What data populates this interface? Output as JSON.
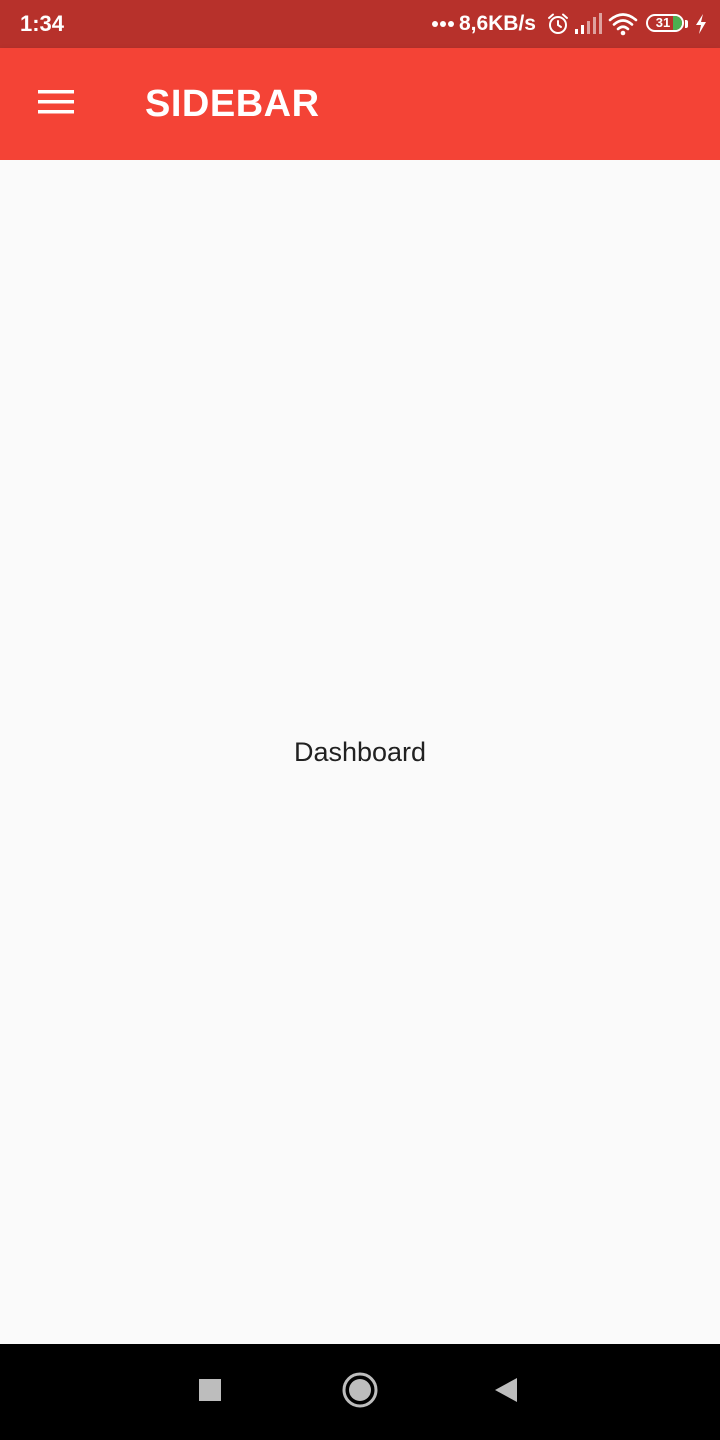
{
  "status_bar": {
    "time": "1:34",
    "network_speed": "8,6KB/s",
    "battery_level": "31",
    "icons": [
      "more-dots-icon",
      "alarm-icon",
      "signal-icon",
      "wifi-icon",
      "battery-icon",
      "charging-icon"
    ]
  },
  "app_bar": {
    "title": "SIDEBAR",
    "menu_icon": "menu-icon"
  },
  "main": {
    "text": "Dashboard"
  },
  "nav_bar": {
    "icons": [
      "recents-icon",
      "home-icon",
      "back-icon"
    ]
  },
  "colors": {
    "status_bar": "#b7312b",
    "app_bar": "#f44336",
    "background": "#fafafa",
    "nav_bar": "#000000",
    "battery_fill": "#4caf50"
  }
}
